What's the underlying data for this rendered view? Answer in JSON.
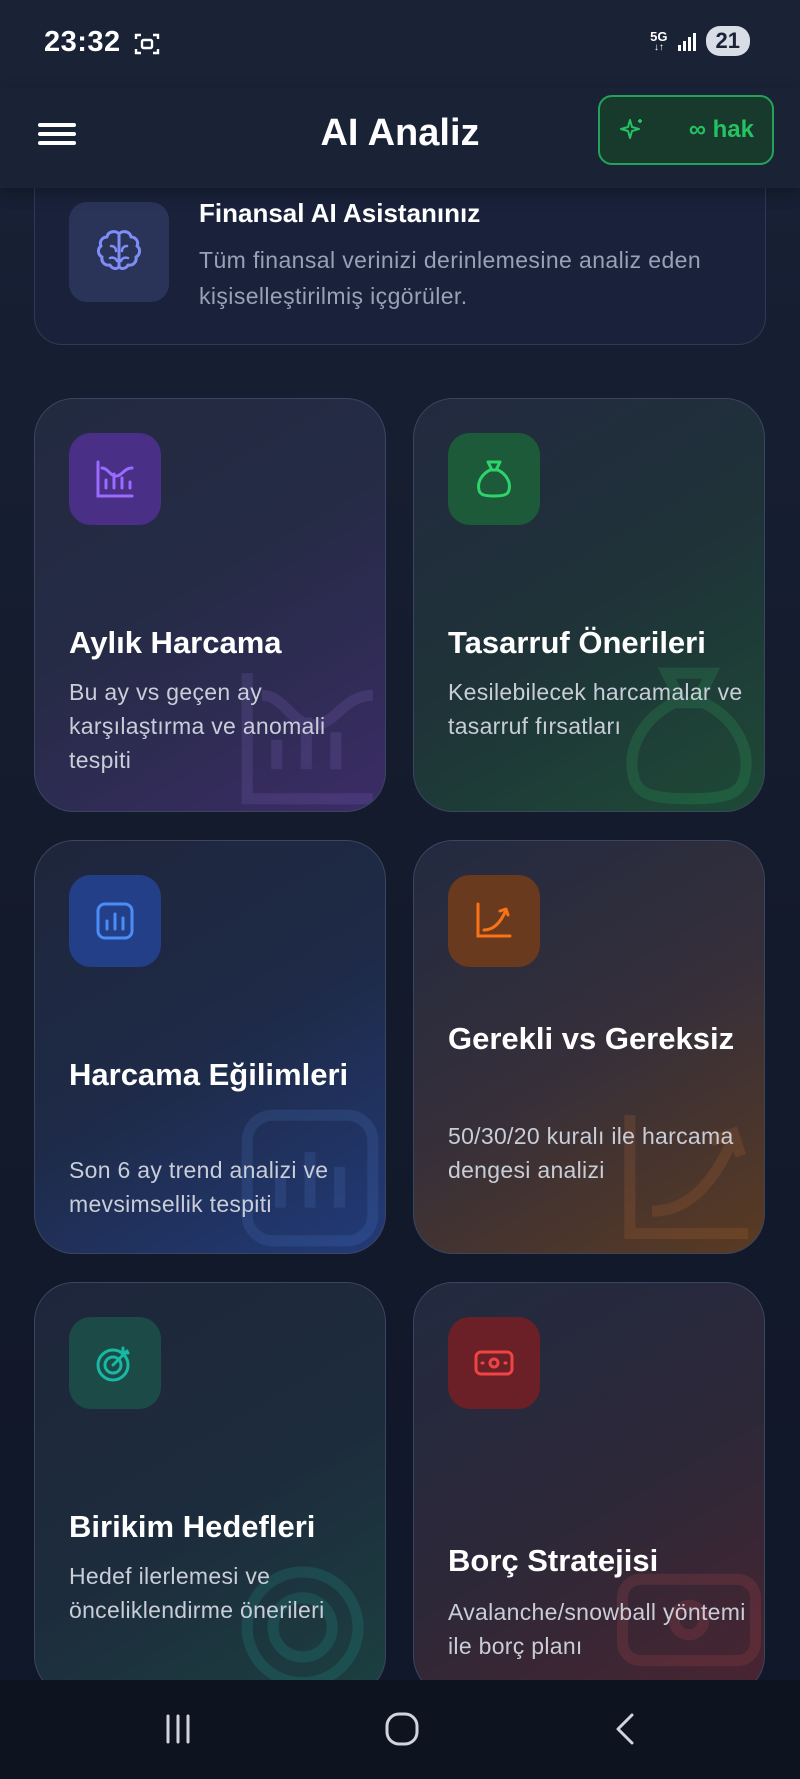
{
  "status": {
    "time": "23:32",
    "network": "5G",
    "battery": "21"
  },
  "appbar": {
    "title": "AI Analiz",
    "quota_label": "∞ hak"
  },
  "assistant": {
    "title": "Finansal AI Asistanınız",
    "description": "Tüm finansal verinizi derinlemesine analiz eden kişiselleştirilmiş içgörüler."
  },
  "cards": [
    {
      "title": "Aylık Harcama",
      "description": "Bu ay vs geçen ay karşılaştırma ve anomali tespiti",
      "icon": "chart-histogram-icon",
      "accent": "#8a4ff0"
    },
    {
      "title": "Tasarruf Önerileri",
      "description": "Kesilebilecek harcamalar ve tasarruf fırsatları",
      "icon": "money-bag-icon",
      "accent": "#22c55e"
    },
    {
      "title": "Harcama Eğilimleri",
      "description": "Son 6 ay trend analizi ve mevsimsellik tespiti",
      "icon": "bar-chart-icon",
      "accent": "#3b82f6"
    },
    {
      "title": "Gerekli vs Gereksiz",
      "description": "50/30/20 kuralı ile harcama dengesi analizi",
      "icon": "trend-up-icon",
      "accent": "#f97316"
    },
    {
      "title": "Birikim Hedefleri",
      "description": "Hedef ilerlemesi ve önceliklendirme önerileri",
      "icon": "target-icon",
      "accent": "#14b8a6"
    },
    {
      "title": "Borç Stratejisi",
      "description": "Avalanche/snowball yöntemi ile borç planı",
      "icon": "banknote-icon",
      "accent": "#ef4444"
    }
  ]
}
